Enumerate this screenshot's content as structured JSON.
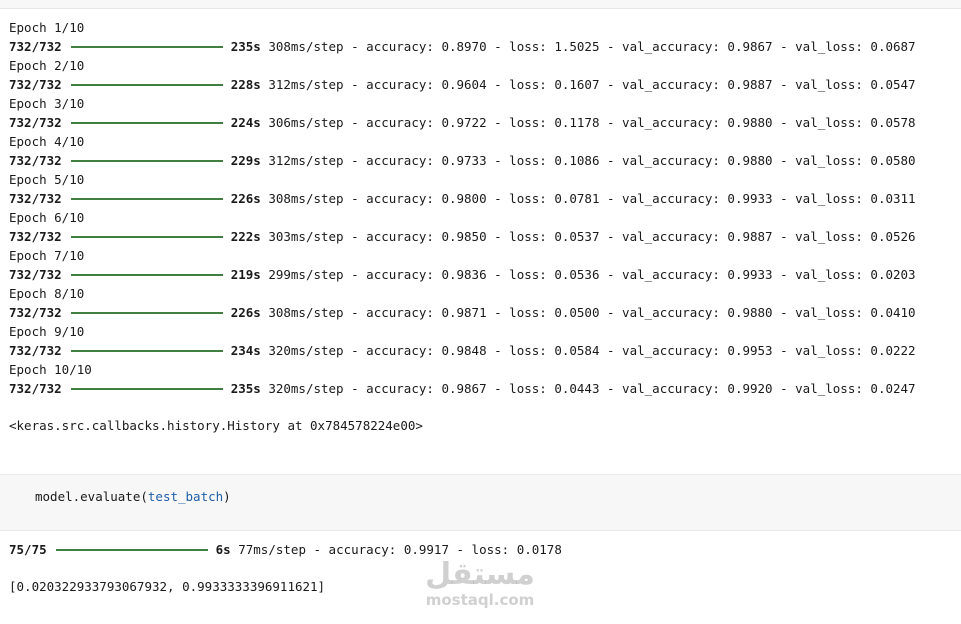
{
  "epochs": [
    {
      "header": "Epoch 1/10",
      "steps": "732/732",
      "time": "235s",
      "step_time": "308ms/step",
      "accuracy": "0.8970",
      "loss": "1.5025",
      "val_accuracy": "0.9867",
      "val_loss": "0.0687"
    },
    {
      "header": "Epoch 2/10",
      "steps": "732/732",
      "time": "228s",
      "step_time": "312ms/step",
      "accuracy": "0.9604",
      "loss": "0.1607",
      "val_accuracy": "0.9887",
      "val_loss": "0.0547"
    },
    {
      "header": "Epoch 3/10",
      "steps": "732/732",
      "time": "224s",
      "step_time": "306ms/step",
      "accuracy": "0.9722",
      "loss": "0.1178",
      "val_accuracy": "0.9880",
      "val_loss": "0.0578"
    },
    {
      "header": "Epoch 4/10",
      "steps": "732/732",
      "time": "229s",
      "step_time": "312ms/step",
      "accuracy": "0.9733",
      "loss": "0.1086",
      "val_accuracy": "0.9880",
      "val_loss": "0.0580"
    },
    {
      "header": "Epoch 5/10",
      "steps": "732/732",
      "time": "226s",
      "step_time": "308ms/step",
      "accuracy": "0.9800",
      "loss": "0.0781",
      "val_accuracy": "0.9933",
      "val_loss": "0.0311"
    },
    {
      "header": "Epoch 6/10",
      "steps": "732/732",
      "time": "222s",
      "step_time": "303ms/step",
      "accuracy": "0.9850",
      "loss": "0.0537",
      "val_accuracy": "0.9887",
      "val_loss": "0.0526"
    },
    {
      "header": "Epoch 7/10",
      "steps": "732/732",
      "time": "219s",
      "step_time": "299ms/step",
      "accuracy": "0.9836",
      "loss": "0.0536",
      "val_accuracy": "0.9933",
      "val_loss": "0.0203"
    },
    {
      "header": "Epoch 8/10",
      "steps": "732/732",
      "time": "226s",
      "step_time": "308ms/step",
      "accuracy": "0.9871",
      "loss": "0.0500",
      "val_accuracy": "0.9880",
      "val_loss": "0.0410"
    },
    {
      "header": "Epoch 9/10",
      "steps": "732/732",
      "time": "234s",
      "step_time": "320ms/step",
      "accuracy": "0.9848",
      "loss": "0.0584",
      "val_accuracy": "0.9953",
      "val_loss": "0.0222"
    },
    {
      "header": "Epoch 10/10",
      "steps": "732/732",
      "time": "235s",
      "step_time": "320ms/step",
      "accuracy": "0.9867",
      "loss": "0.0443",
      "val_accuracy": "0.9920",
      "val_loss": "0.0247"
    }
  ],
  "labels": {
    "accuracy": " - accuracy: ",
    "loss": " - loss: ",
    "val_accuracy": " - val_accuracy: ",
    "val_loss": " - val_loss: "
  },
  "fit_result": "<keras.src.callbacks.history.History at 0x784578224e00>",
  "code_cell": {
    "func": "model.evaluate(",
    "arg": "test_batch",
    "close": ")"
  },
  "evaluate": {
    "steps": "75/75",
    "time": "6s",
    "step_time": "77ms/step",
    "accuracy": "0.9917",
    "loss": "0.0178"
  },
  "evaluate_result": "[0.020322933793067932, 0.9933333396911621]",
  "progress_color": "#3f7f3f",
  "watermark": {
    "logo": "مستقل",
    "text": "mostaql.com"
  }
}
